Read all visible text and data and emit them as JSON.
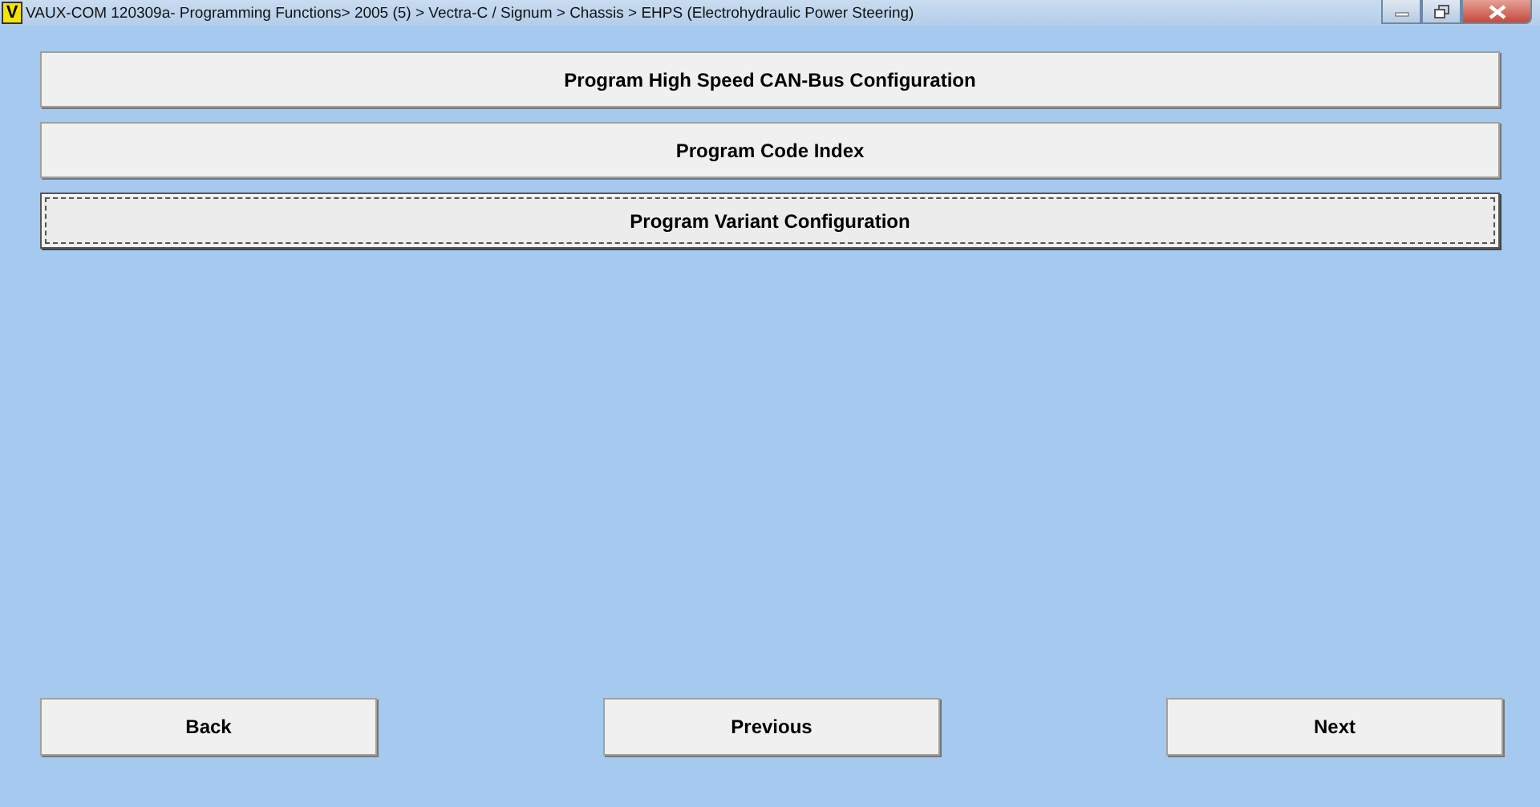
{
  "window": {
    "title": "VAUX-COM 120309a- Programming Functions> 2005 (5) > Vectra-C / Signum > Chassis > EHPS (Electrohydraulic Power Steering)",
    "logo": "V"
  },
  "options": [
    {
      "label": "Program High Speed CAN-Bus Configuration",
      "focused": false
    },
    {
      "label": "Program Code Index",
      "focused": false
    },
    {
      "label": "Program Variant Configuration",
      "focused": true
    }
  ],
  "nav_buttons": [
    "Back",
    "Previous",
    "Next"
  ]
}
